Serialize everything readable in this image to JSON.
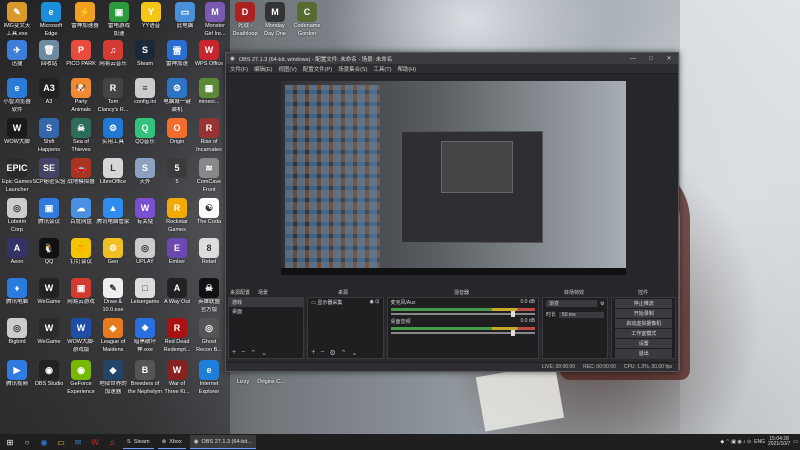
{
  "desktop": {
    "icons": [
      {
        "label": "IMG变文天\n工具.exe",
        "color": "#d99a2b",
        "glyph": "✎"
      },
      {
        "label": "Microsoft\nEdge",
        "color": "#1a8fd8",
        "glyph": "e"
      },
      {
        "label": "雷神加速器",
        "color": "#f0a020",
        "glyph": "⚡"
      },
      {
        "label": "雷电游戏\n加速",
        "color": "#2b9a3e",
        "glyph": "▣"
      },
      {
        "label": "YY语音",
        "color": "#f5c518",
        "glyph": "Y"
      },
      {
        "label": "此电脑",
        "color": "#4a90d9",
        "glyph": "▭"
      },
      {
        "label": "Monster\nGirl Ire...",
        "color": "#7a5ab0",
        "glyph": "M"
      },
      {
        "label": "死战 -\nDeathloop",
        "color": "#aa2222",
        "glyph": "D"
      },
      {
        "label": "Monday\nDay One",
        "color": "#333333",
        "glyph": "M"
      },
      {
        "label": "Codename\nGordon",
        "color": "#556b2f",
        "glyph": "C"
      },
      {
        "label": "迅捷",
        "color": "#3d7edb",
        "glyph": "✈"
      },
      {
        "label": "回收站",
        "color": "#6c8aa0",
        "glyph": "🗑"
      },
      {
        "label": "PICO PARK",
        "color": "#e84c3d",
        "glyph": "P"
      },
      {
        "label": "网易云音乐",
        "color": "#d33a31",
        "glyph": "♫"
      },
      {
        "label": "Steam",
        "color": "#1b2838",
        "glyph": "S"
      },
      {
        "label": "雷神加速",
        "color": "#2a6fcf",
        "glyph": "雷"
      },
      {
        "label": "WPS Office",
        "color": "#c8262c",
        "glyph": "W"
      },
      {
        "label": "小智浏览器\n软件",
        "color": "#2a7bd8",
        "glyph": "e"
      },
      {
        "label": "A3",
        "color": "#222222",
        "glyph": "A3"
      },
      {
        "label": "Party\nAnimals",
        "color": "#f08a30",
        "glyph": "🐶"
      },
      {
        "label": "Tom\nClancy's R...",
        "color": "#444444",
        "glyph": "R"
      },
      {
        "label": "config.ini",
        "color": "#cccccc",
        "glyph": "≡"
      },
      {
        "label": "电脑城一键\n装机",
        "color": "#2d74c6",
        "glyph": "⚙"
      },
      {
        "label": "minecr...",
        "color": "#5c8a3a",
        "glyph": "▦"
      },
      {
        "label": "WOW大脚",
        "color": "#1a1a1a",
        "glyph": "W"
      },
      {
        "label": "Shift\nHappens",
        "color": "#3366aa",
        "glyph": "S"
      },
      {
        "label": "Sea of\nThieves",
        "color": "#2d6b5a",
        "glyph": "☠"
      },
      {
        "label": "实用工具",
        "color": "#2077d4",
        "glyph": "⚙"
      },
      {
        "label": "QQ音乐",
        "color": "#31c27c",
        "glyph": "Q"
      },
      {
        "label": "Origin",
        "color": "#f56c2d",
        "glyph": "O"
      },
      {
        "label": "Rise of\nIncarnates",
        "color": "#993333",
        "glyph": "R"
      },
      {
        "label": "Epic Games\nLauncher",
        "color": "#2a2a2a",
        "glyph": "EPIC"
      },
      {
        "label": "SCP秘密实验",
        "color": "#444466",
        "glyph": "SE"
      },
      {
        "label": "战地模拟器",
        "color": "#aa3322",
        "glyph": "🚗"
      },
      {
        "label": "LibreOffice",
        "color": "#d6d6d6",
        "glyph": "L"
      },
      {
        "label": "天外",
        "color": "#8aa1c0",
        "glyph": "S"
      },
      {
        "label": "5",
        "color": "#3b3b3b",
        "glyph": "5"
      },
      {
        "label": "ComCave\nFront",
        "color": "#888888",
        "glyph": "≋"
      },
      {
        "label": "Lobotm\nCorp",
        "color": "#cccccc",
        "glyph": "◎"
      },
      {
        "label": "腾讯会议",
        "color": "#2f7be0",
        "glyph": "▣"
      },
      {
        "label": "百度网盘",
        "color": "#4a90e2",
        "glyph": "☁"
      },
      {
        "label": "腾讯电脑管家",
        "color": "#2d8cf0",
        "glyph": "▲"
      },
      {
        "label": "有关使",
        "color": "#7a4fd0",
        "glyph": "W"
      },
      {
        "label": "Rockstar\nGames",
        "color": "#f2a900",
        "glyph": "R"
      },
      {
        "label": "The Coda",
        "color": "#ffffff",
        "glyph": "☯"
      },
      {
        "label": "Aeon",
        "color": "#333366",
        "glyph": "A"
      },
      {
        "label": "QQ",
        "color": "#111111",
        "glyph": "🐧"
      },
      {
        "label": "钉钉会议",
        "color": "#f5c400",
        "glyph": "🐥"
      },
      {
        "label": "Geo",
        "color": "#f0c020",
        "glyph": "⚙"
      },
      {
        "label": "UPLAY",
        "color": "#cccccc",
        "glyph": "◎"
      },
      {
        "label": "Ember",
        "color": "#6a4ab0",
        "glyph": "E"
      },
      {
        "label": "Rebel",
        "color": "#dddddd",
        "glyph": "8"
      },
      {
        "label": "腾讯电脑",
        "color": "#2a7be0",
        "glyph": "♦"
      },
      {
        "label": "WeGame",
        "color": "#222222",
        "glyph": "W"
      },
      {
        "label": "网易云游戏",
        "color": "#d33a31",
        "glyph": "▣"
      },
      {
        "label": "Draw &\n10.0.exe",
        "color": "#eeeeee",
        "glyph": "✎"
      },
      {
        "label": "Leisergame",
        "color": "#dddddd",
        "glyph": "□"
      },
      {
        "label": "A Way Out",
        "color": "#222222",
        "glyph": "A"
      },
      {
        "label": "英雄联盟\n官方版",
        "color": "#111111",
        "glyph": "☠"
      },
      {
        "label": "Bigbird",
        "color": "#cccccc",
        "glyph": "◎"
      },
      {
        "label": "WeGame",
        "color": "#2a2a2a",
        "glyph": "W"
      },
      {
        "label": "WOW大脚-\n游戏版",
        "color": "#1e4ea8",
        "glyph": "W"
      },
      {
        "label": "League of\nMaidens",
        "color": "#e87a1e",
        "glyph": "◆"
      },
      {
        "label": "暗黑破坏\n神.exe",
        "color": "#2a6fdf",
        "glyph": "❖"
      },
      {
        "label": "Red Dead\nRedempt...",
        "color": "#aa1111",
        "glyph": "R"
      },
      {
        "label": "Ghost\nRecon B...",
        "color": "#555555",
        "glyph": "◎"
      },
      {
        "label": "腾讯视频",
        "color": "#2f7be0",
        "glyph": "▶"
      },
      {
        "label": "OBS Studio",
        "color": "#222222",
        "glyph": "◉"
      },
      {
        "label": "GeForce\nExperience",
        "color": "#76b900",
        "glyph": "◉"
      },
      {
        "label": "地狱世界的\n加速器",
        "color": "#224466",
        "glyph": "◆"
      },
      {
        "label": "Breeders of\nthe Nephelym",
        "color": "#555555",
        "glyph": "B"
      },
      {
        "label": "War of\nThree Ki...",
        "color": "#882222",
        "glyph": "W"
      },
      {
        "label": "Internet\nExplorer",
        "color": "#1e7fd8",
        "glyph": "e"
      }
    ],
    "extra": [
      {
        "label": "Lizzy",
        "glyph": "≡",
        "color": "#dddddd"
      },
      {
        "label": "Origins C...",
        "glyph": "□",
        "color": "#cccccc"
      }
    ]
  },
  "obs": {
    "title": "OBS 27.1.3 (64-bit, windows) - 配置文件: 未命名 - 场景: 未命名",
    "window_buttons": [
      "—",
      "□",
      "✕"
    ],
    "menu": [
      "文件(F)",
      "编辑(E)",
      "视图(V)",
      "配置文件(P)",
      "场景集合(S)",
      "工具(T)",
      "帮助(H)"
    ],
    "preview_label": "来源配置",
    "dock_titles": {
      "scenes": "场景",
      "sources": "来源",
      "mixer": "混音器",
      "transitions": "转场特效",
      "controls": "控件"
    },
    "scenes": [
      "游戏",
      "桌面"
    ],
    "sources": [
      "显示器采集"
    ],
    "mixer": [
      {
        "name": "麦克风/Aux",
        "db": "0.0 dB"
      },
      {
        "name": "桌面音频",
        "db": "0.0 dB"
      }
    ],
    "transitions": {
      "type": "渐变",
      "duration_label": "时长",
      "duration_value": "50 ms"
    },
    "controls": [
      "停止推流",
      "开始录制",
      "启动虚拟摄像机",
      "工作室模式",
      "设置",
      "退出"
    ],
    "status": {
      "live": "LIVE: 00:00:00",
      "rec": "REC: 00:00:00",
      "cpu": "CPU: 1.3%, 30.00 fps"
    }
  },
  "taskbar": {
    "start_glyph": "⊞",
    "pinned": [
      {
        "name": "search",
        "glyph": "○",
        "color": "#dddddd"
      },
      {
        "name": "browser",
        "glyph": "◉",
        "color": "#2a7bd8"
      },
      {
        "name": "files",
        "glyph": "▭",
        "color": "#f0c040"
      },
      {
        "name": "mail",
        "glyph": "✉",
        "color": "#3d7edb"
      },
      {
        "name": "wps",
        "glyph": "W",
        "color": "#c8262c"
      },
      {
        "name": "netease",
        "glyph": "♫",
        "color": "#d33a31"
      }
    ],
    "apps": [
      {
        "label": "Steam",
        "glyph": "S",
        "active": false
      },
      {
        "label": "Xbox",
        "glyph": "⊗",
        "active": false
      },
      {
        "label": "OBS 27.1.3 (64-bit...",
        "glyph": "◉",
        "active": true
      }
    ],
    "tray": {
      "lang": "ENG",
      "time": "15:04:28",
      "date": "2021/10/7"
    }
  }
}
